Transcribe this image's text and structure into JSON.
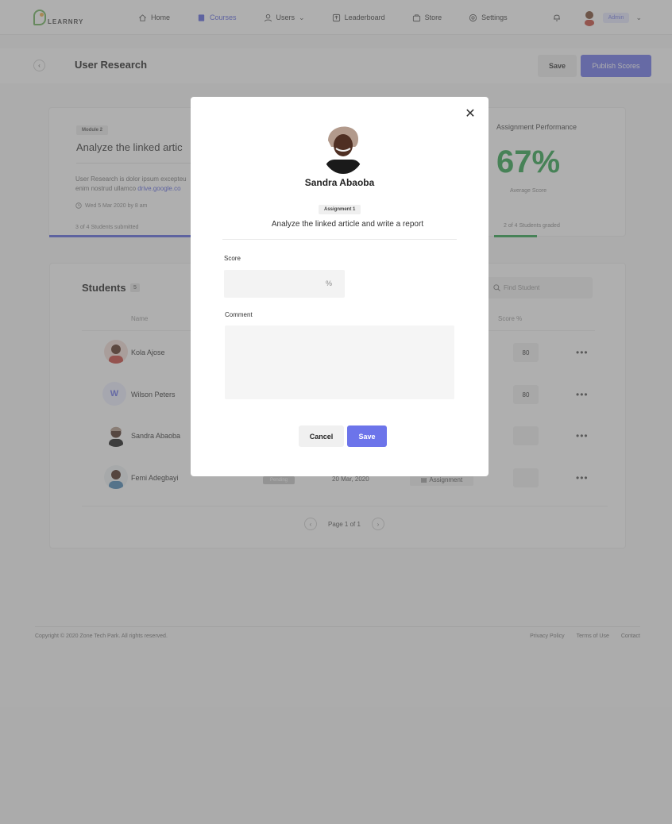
{
  "brand": {
    "name": "LEARNRY"
  },
  "nav": {
    "items": [
      {
        "label": "Home",
        "icon": "home-icon"
      },
      {
        "label": "Courses",
        "icon": "book-icon",
        "active": true
      },
      {
        "label": "Users",
        "icon": "user-icon"
      },
      {
        "label": "Leaderboard",
        "icon": "leaderboard-icon"
      },
      {
        "label": "Store",
        "icon": "bag-icon"
      },
      {
        "label": "Settings",
        "icon": "gear-icon"
      }
    ],
    "user_role": "Admin"
  },
  "header": {
    "title": "User Research",
    "save_label": "Save",
    "publish_label": "Publish Scores"
  },
  "assignment": {
    "module": "Module 2",
    "title": "Analyze the linked artic",
    "description": "User Research is dolor ipsum excepteu enim nostrud ullamco",
    "link": "drive.google.co",
    "date": "Wed 5 Mar 2020 by 8 am",
    "submitted": "3 of 4 Students submitted"
  },
  "performance": {
    "title": "Assignment Performance",
    "value": "67%",
    "label": "Average Score",
    "graded": "2 of 4 Students graded"
  },
  "students": {
    "title": "Students",
    "count": "5",
    "search_placeholder": "Find Student",
    "col_name": "Name",
    "col_score": "Score %",
    "rows": [
      {
        "name": "Kola Ajose",
        "score": "80"
      },
      {
        "name": "Wilson Peters",
        "initial": "W",
        "score": "80"
      },
      {
        "name": "Sandra Abaoba",
        "score": ""
      },
      {
        "name": "Femi Adegbayi",
        "score": "",
        "status": "Pending",
        "date": "20 Mar, 2020",
        "type": "Assignment"
      }
    ],
    "pagination": "Page 1 of 1"
  },
  "footer": {
    "copyright": "Copyright © 2020 Zone Tech Park. All rights reserved.",
    "links": [
      "Privacy Policy",
      "Terms of Use",
      "Contact"
    ]
  },
  "modal": {
    "student_name": "Sandra Abaoba",
    "badge": "Assignment 1",
    "assignment_title": "Analyze the linked article and write a report",
    "score_label": "Score",
    "score_value": "",
    "score_unit": "%",
    "comment_label": "Comment",
    "comment_value": "",
    "cancel_label": "Cancel",
    "save_label": "Save"
  },
  "colors": {
    "accent": "#6c74ea",
    "success": "#2fa44f"
  }
}
